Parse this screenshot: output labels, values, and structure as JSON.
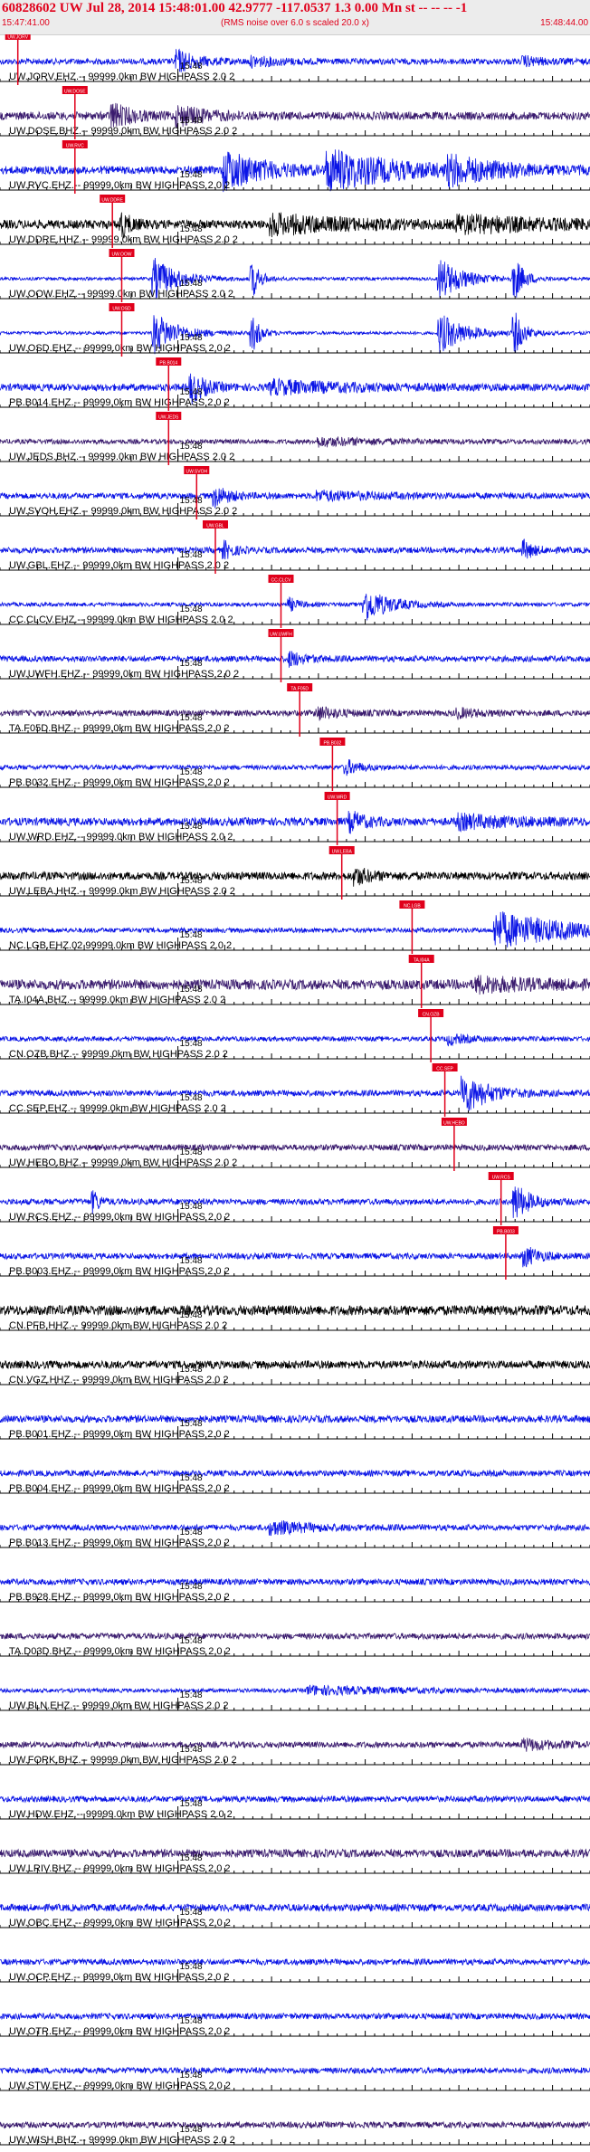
{
  "header": {
    "title": "60828602 UW Jul 28, 2014 15:48:01.00   42.9777 -117.0537  1.3 0.00 Mn st -- -- --  -1",
    "subtitle": "(RMS noise over 6.0 s scaled 20.0 x)",
    "time_start": "15:47:41.00",
    "time_end": "15:48:44.00"
  },
  "colors": {
    "blue": "#0a14e6",
    "black": "#000000",
    "purple": "#3a1b6e",
    "pick": "#e0001b",
    "axis": "#000000"
  },
  "chart_data": {
    "type": "line",
    "title": "60828602 UW Jul 28, 2014 15:48:01.00   42.9777 -117.0537  1.3 0.00 Mn st -- -- --  -1",
    "xlim": [
      "15:47:41.00",
      "15:48:44.00"
    ],
    "tick_label": "15:48",
    "traces": [
      {
        "label": "UW.JORV.EHZ.-- 99999.0km BW  HIGHPASS  2.0  2",
        "color": "blue",
        "amp": 0.15,
        "pick": "15:47:42.9",
        "pick_label": "UW.JORV",
        "bursts": [
          {
            "t": "15:48:00.0",
            "a": 0.55,
            "w": 2.0
          },
          {
            "t": "15:48:08.0",
            "a": 0.2,
            "w": 3.0
          },
          {
            "t": "15:48:37.0",
            "a": 0.2,
            "w": 2.0
          }
        ]
      },
      {
        "label": "UW.DOSE.BHZ.-- 99999.0km BW  HIGHPASS  2.0  2",
        "color": "purple",
        "amp": 0.2,
        "pick": "15:47:49.0",
        "pick_label": "UW.DOSE",
        "bursts": [
          {
            "t": "15:47:53.0",
            "a": 0.6,
            "w": 2.0
          },
          {
            "t": "15:48:00.0",
            "a": 0.45,
            "w": 3.0
          }
        ]
      },
      {
        "label": "UW.RVC.EHZ.-- 99999.0km BW  HIGHPASS  2.0  2",
        "color": "blue",
        "amp": 0.2,
        "pick": "15:47:49.0",
        "pick_label": "UW.RVC",
        "bursts": [
          {
            "t": "15:48:05.0",
            "a": 1.0,
            "w": 4.0
          },
          {
            "t": "15:48:16.0",
            "a": 1.0,
            "w": 7.0
          },
          {
            "t": "15:48:29.0",
            "a": 0.6,
            "w": 5.0
          }
        ]
      },
      {
        "label": "UW.DDRE.HHZ.-- 99999.0km BW  HIGHPASS  2.0  2",
        "color": "black",
        "amp": 0.22,
        "pick": "15:47:53.0",
        "pick_label": "UW.DDRE",
        "bursts": [
          {
            "t": "15:47:54.0",
            "a": 0.6,
            "w": 1.0
          },
          {
            "t": "15:48:10.0",
            "a": 0.45,
            "w": 8.0
          },
          {
            "t": "15:48:30.0",
            "a": 0.35,
            "w": 10.0
          }
        ]
      },
      {
        "label": "UW.OOW.EHZ.-- 99999.0km BW  HIGHPASS  2.0  2",
        "color": "blue",
        "amp": 0.08,
        "pick": "15:47:54.0",
        "pick_label": "UW.OOW",
        "bursts": [
          {
            "t": "15:47:57.5",
            "a": 1.0,
            "w": 2.5
          },
          {
            "t": "15:48:08.0",
            "a": 0.9,
            "w": 0.8
          },
          {
            "t": "15:48:28.0",
            "a": 1.0,
            "w": 2.5
          },
          {
            "t": "15:48:36.0",
            "a": 1.0,
            "w": 1.0
          }
        ]
      },
      {
        "label": "UW.OSD.EHZ.-- 99999.0km BW  HIGHPASS  2.0  2",
        "color": "blue",
        "amp": 0.08,
        "pick": "15:47:54.0",
        "pick_label": "UW.OSD",
        "bursts": [
          {
            "t": "15:47:57.5",
            "a": 1.0,
            "w": 2.5
          },
          {
            "t": "15:48:08.0",
            "a": 0.9,
            "w": 0.8
          },
          {
            "t": "15:48:28.0",
            "a": 1.0,
            "w": 2.5
          },
          {
            "t": "15:48:36.0",
            "a": 1.0,
            "w": 1.0
          }
        ]
      },
      {
        "label": "PB.B014.EHZ.-- 99999.0km BW  HIGHPASS  2.0  2",
        "color": "blue",
        "amp": 0.18,
        "pick": "15:47:59.0",
        "pick_label": "PB.B014",
        "bursts": [
          {
            "t": "15:48:01.5",
            "a": 0.7,
            "w": 1.5
          },
          {
            "t": "15:48:10.0",
            "a": 0.3,
            "w": 8.0
          }
        ]
      },
      {
        "label": "UW.JEDS.BHZ.-- 99999.0km BW  HIGHPASS  2.0  2",
        "color": "purple",
        "amp": 0.12,
        "pick": "15:47:59.0",
        "pick_label": "UW.JEDS",
        "bursts": [
          {
            "t": "15:48:15.0",
            "a": 0.2,
            "w": 6.0
          }
        ]
      },
      {
        "label": "UW.SVOH.EHZ.-- 99999.0km BW  HIGHPASS  2.0  2",
        "color": "blue",
        "amp": 0.15,
        "pick": "15:48:02.0",
        "pick_label": "UW.SVOH",
        "bursts": [
          {
            "t": "15:48:04.0",
            "a": 0.5,
            "w": 1.5
          },
          {
            "t": "15:48:15.0",
            "a": 0.2,
            "w": 6.0
          }
        ]
      },
      {
        "label": "UW.GBL.EHZ.-- 99999.0km BW  HIGHPASS  2.0  2",
        "color": "blue",
        "amp": 0.15,
        "pick": "15:48:04.0",
        "pick_label": "UW.GBL",
        "bursts": [
          {
            "t": "15:48:05.0",
            "a": 0.4,
            "w": 1.0
          },
          {
            "t": "15:48:37.0",
            "a": 0.45,
            "w": 1.0
          }
        ]
      },
      {
        "label": "CC.CLCV.EHZ.-- 99999.0km BW  HIGHPASS  2.0  2",
        "color": "blue",
        "amp": 0.1,
        "pick": "15:48:11.0",
        "pick_label": "CC.CLCV",
        "bursts": [
          {
            "t": "15:48:12.0",
            "a": 0.3,
            "w": 1.0
          },
          {
            "t": "15:48:20.0",
            "a": 0.85,
            "w": 2.5
          }
        ]
      },
      {
        "label": "UW.UWFH.EHZ.-- 99999.0km BW  HIGHPASS  2.0  2",
        "color": "blue",
        "amp": 0.15,
        "pick": "15:48:11.0",
        "pick_label": "UW.UWFH",
        "bursts": [
          {
            "t": "15:48:12.0",
            "a": 0.35,
            "w": 1.5
          }
        ]
      },
      {
        "label": "TA.F05D.BHZ.-- 99999.0km BW  HIGHPASS  2.0  2",
        "color": "purple",
        "amp": 0.15,
        "pick": "15:48:13.0",
        "pick_label": "TA.F05D",
        "bursts": [
          {
            "t": "15:48:15.0",
            "a": 0.3,
            "w": 2.0
          },
          {
            "t": "15:48:30.0",
            "a": 0.2,
            "w": 2.0
          }
        ]
      },
      {
        "label": "PB.B032.EHZ.-- 99999.0km BW  HIGHPASS  2.0  2",
        "color": "blue",
        "amp": 0.12,
        "pick": "15:48:16.5",
        "pick_label": "PB.B032",
        "bursts": [
          {
            "t": "15:48:18.0",
            "a": 0.35,
            "w": 1.5
          }
        ]
      },
      {
        "label": "UW.WRD.EHZ.-- 99999.0km BW  HIGHPASS  2.0  2",
        "color": "blue",
        "amp": 0.2,
        "pick": "15:48:17.0",
        "pick_label": "UW.WRD",
        "bursts": [
          {
            "t": "15:48:18.5",
            "a": 0.45,
            "w": 1.5
          },
          {
            "t": "15:48:30.0",
            "a": 0.3,
            "w": 6.0
          }
        ]
      },
      {
        "label": "UW.LEBA.HHZ.-- 99999.0km BW  HIGHPASS  2.0  2",
        "color": "black",
        "amp": 0.2,
        "pick": "15:48:17.5",
        "pick_label": "UW.LEBA",
        "bursts": [
          {
            "t": "15:48:19.0",
            "a": 0.4,
            "w": 1.5
          }
        ]
      },
      {
        "label": "NC.LGB.EHZ.02 99999.0km BW  HIGHPASS  2.0  2",
        "color": "blue",
        "amp": 0.12,
        "pick": "15:48:25.0",
        "pick_label": "NC.LGB",
        "bursts": [
          {
            "t": "15:48:34.0",
            "a": 0.9,
            "w": 8.0
          }
        ]
      },
      {
        "label": "TA.I04A.BHZ.-- 99999.0km BW  HIGHPASS  2.0  2",
        "color": "purple",
        "amp": 0.25,
        "pick": "15:48:26.0",
        "pick_label": "TA.I04A",
        "bursts": [
          {
            "t": "15:48:32.0",
            "a": 0.3,
            "w": 6.0
          }
        ]
      },
      {
        "label": "CN.OZB.BHZ.-- 99999.0km BW  HIGHPASS  2.0  2",
        "color": "blue",
        "amp": 0.12,
        "pick": "15:48:27.0",
        "pick_label": "CN.OZB",
        "bursts": [
          {
            "t": "15:48:29.0",
            "a": 0.25,
            "w": 2.0
          }
        ]
      },
      {
        "label": "CC.SEP.EHZ.-- 99999.0km BW  HIGHPASS  2.0  2",
        "color": "blue",
        "amp": 0.15,
        "pick": "15:48:28.5",
        "pick_label": "CC.SEP",
        "bursts": [
          {
            "t": "15:48:30.5",
            "a": 1.0,
            "w": 2.5
          }
        ]
      },
      {
        "label": "UW.HEBO.BHZ.-- 99999.0km BW  HIGHPASS  2.0  2",
        "color": "purple",
        "amp": 0.15,
        "pick": "15:48:29.5",
        "pick_label": "UW.HEBO",
        "bursts": []
      },
      {
        "label": "UW.RCS.EHZ.-- 99999.0km BW  HIGHPASS  2.0  2",
        "color": "blue",
        "amp": 0.15,
        "pick": "15:48:34.5",
        "pick_label": "UW.RCS",
        "bursts": [
          {
            "t": "15:47:51.0",
            "a": 0.6,
            "w": 0.6
          },
          {
            "t": "15:48:36.0",
            "a": 0.9,
            "w": 1.5
          }
        ]
      },
      {
        "label": "PB.B003.EHZ.-- 99999.0km BW  HIGHPASS  2.0  2",
        "color": "blue",
        "amp": 0.15,
        "pick": "15:48:35.0",
        "pick_label": "PB.B003",
        "bursts": [
          {
            "t": "15:48:37.0",
            "a": 0.5,
            "w": 1.5
          }
        ]
      },
      {
        "label": "CN.PFB.HHZ.-- 99999.0km BW  HIGHPASS  2.0  2",
        "color": "black",
        "amp": 0.25,
        "bursts": []
      },
      {
        "label": "CN.VGZ.HHZ.-- 99999.0km BW  HIGHPASS  2.0  2",
        "color": "black",
        "amp": 0.2,
        "bursts": []
      },
      {
        "label": "PB.B001.EHZ.-- 99999.0km BW  HIGHPASS  2.0  2",
        "color": "blue",
        "amp": 0.18,
        "bursts": []
      },
      {
        "label": "PB.B004.EHZ.-- 99999.0km BW  HIGHPASS  2.0  2",
        "color": "blue",
        "amp": 0.15,
        "bursts": []
      },
      {
        "label": "PB.B013.EHZ.-- 99999.0km BW  HIGHPASS  2.0  2",
        "color": "blue",
        "amp": 0.15,
        "bursts": [
          {
            "t": "15:48:10.0",
            "a": 0.3,
            "w": 4.0
          }
        ]
      },
      {
        "label": "PB.B928.EHZ.-- 99999.0km BW  HIGHPASS  2.0  2",
        "color": "blue",
        "amp": 0.15,
        "bursts": []
      },
      {
        "label": "TA.D03D.BHZ.-- 99999.0km BW  HIGHPASS  2.0  2",
        "color": "purple",
        "amp": 0.15,
        "bursts": []
      },
      {
        "label": "UW.BLN.EHZ.-- 99999.0km BW  HIGHPASS  2.0  2",
        "color": "blue",
        "amp": 0.1,
        "bursts": [
          {
            "t": "15:48:14.0",
            "a": 0.2,
            "w": 10.0
          }
        ]
      },
      {
        "label": "UW.FORK.BHZ.-- 99999.0km BW  HIGHPASS  2.0  2",
        "color": "purple",
        "amp": 0.15,
        "bursts": [
          {
            "t": "15:48:37.0",
            "a": 0.25,
            "w": 3.0
          }
        ]
      },
      {
        "label": "UW.HDW.EHZ.-- 99999.0km BW  HIGHPASS  2.0  2",
        "color": "blue",
        "amp": 0.15,
        "bursts": []
      },
      {
        "label": "UW.LRIV.BHZ.-- 99999.0km BW  HIGHPASS  2.0  2",
        "color": "purple",
        "amp": 0.2,
        "bursts": []
      },
      {
        "label": "UW.OBC.EHZ.-- 99999.0km BW  HIGHPASS  2.0  2",
        "color": "blue",
        "amp": 0.18,
        "bursts": []
      },
      {
        "label": "UW.OCP.EHZ.-- 99999.0km BW  HIGHPASS  2.0  2",
        "color": "blue",
        "amp": 0.15,
        "bursts": []
      },
      {
        "label": "UW.OTR.EHZ.-- 99999.0km BW  HIGHPASS  2.0  2",
        "color": "blue",
        "amp": 0.15,
        "bursts": []
      },
      {
        "label": "UW.STW.EHZ.-- 99999.0km BW  HIGHPASS  2.0  2",
        "color": "blue",
        "amp": 0.15,
        "bursts": []
      },
      {
        "label": "UW.WISH.BHZ.-- 99999.0km BW  HIGHPASS  2.0  2",
        "color": "purple",
        "amp": 0.15,
        "bursts": []
      }
    ]
  }
}
